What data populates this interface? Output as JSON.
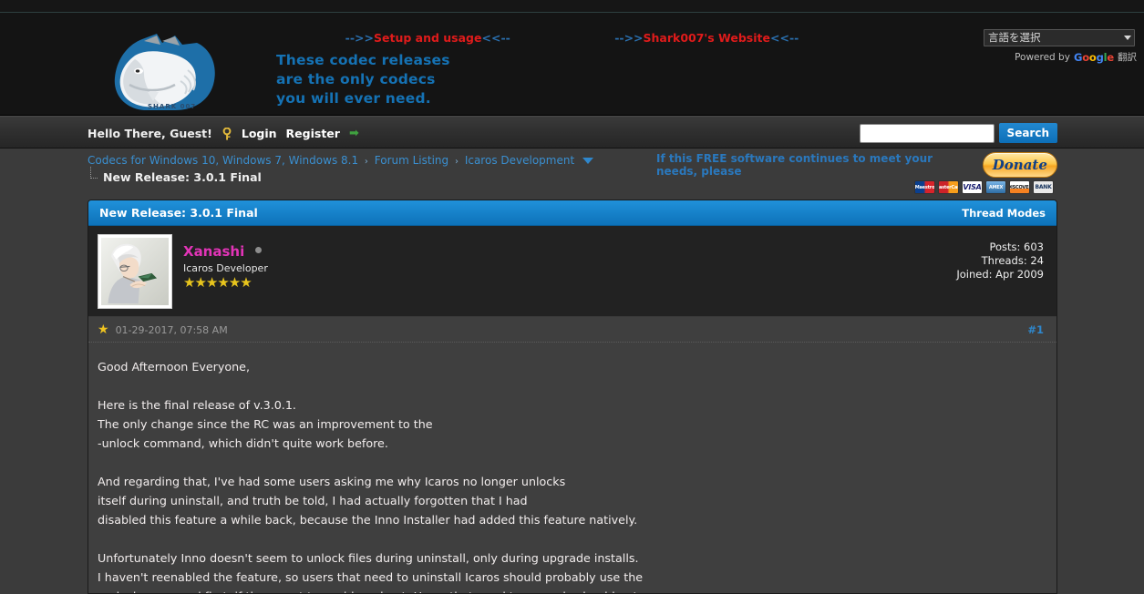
{
  "header": {
    "tagline_lines": [
      "These codec releases",
      "are the only codecs",
      "you will ever need."
    ],
    "logo_caption": "SHARK 007",
    "top_links": [
      {
        "prefix": "-->>",
        "label": "Setup and usage",
        "suffix": "<<--"
      },
      {
        "prefix": "-->>",
        "label": "Shark007's Website",
        "suffix": "<<--"
      }
    ],
    "translate": {
      "selected": "言語を選択",
      "powered_prefix": "Powered by",
      "brand_letters": [
        "G",
        "o",
        "o",
        "g",
        "l",
        "e"
      ],
      "suffix": "翻訳"
    }
  },
  "userbar": {
    "greeting": "Hello There, Guest!",
    "login_label": "Login",
    "register_label": "Register",
    "key_icon": "key-icon",
    "arrow_icon": "green-arrow-icon",
    "search_value": "",
    "search_placeholder": "",
    "search_button": "Search"
  },
  "breadcrumb": {
    "items": [
      "Codecs for Windows 10, Windows 7, Windows 8.1",
      "Forum Listing",
      "Icaros Development"
    ],
    "separator": "›",
    "current": "New Release: 3.0.1 Final"
  },
  "donate": {
    "text": "If this FREE software continues to meet your needs, please",
    "button_label": "Donate",
    "cards": [
      "Maestro",
      "MasterCard",
      "VISA",
      "AMEX",
      "DISCOVER",
      "BANK"
    ]
  },
  "thread": {
    "title": "New Release: 3.0.1 Final",
    "modes_label": "Thread Modes"
  },
  "post": {
    "author": {
      "name": "Xanashi",
      "status": "offline",
      "title": "Icaros Developer",
      "stars": "★★★★★★",
      "avatar_alt": "user-avatar"
    },
    "stats": {
      "posts": "Posts: 603",
      "threads": "Threads: 24",
      "joined": "Joined: Apr 2009"
    },
    "date": "01-29-2017, 07:58 AM",
    "number": "#1",
    "body": "Good Afternoon Everyone,\n\nHere is the final release of v.3.0.1.\nThe only change since the RC was an improvement to the\n-unlock command, which didn't quite work before.\n\nAnd regarding that, I've had some users asking me why Icaros no longer unlocks\nitself during uninstall, and truth be told, I had actually forgotten that I had\ndisabled this feature a while back, because the Inno Installer had added this feature natively.\n\nUnfortunately Inno doesn't seem to unlock files during uninstall, only during upgrade installs.\nI haven't reenabled the feature, so users that need to uninstall Icaros should probably use the\n-unlock command first, if they want to avoid a reboot. Users that need to upgrade should get proper"
  },
  "colors": {
    "accent_blue": "#1572b4",
    "link_blue": "#3a8fd0",
    "red_link": "#e01b1b",
    "author_pink": "#e234b7",
    "star_gold": "#e8c51d",
    "header_bg": "#141414",
    "page_bg": "#3b3b3b"
  }
}
